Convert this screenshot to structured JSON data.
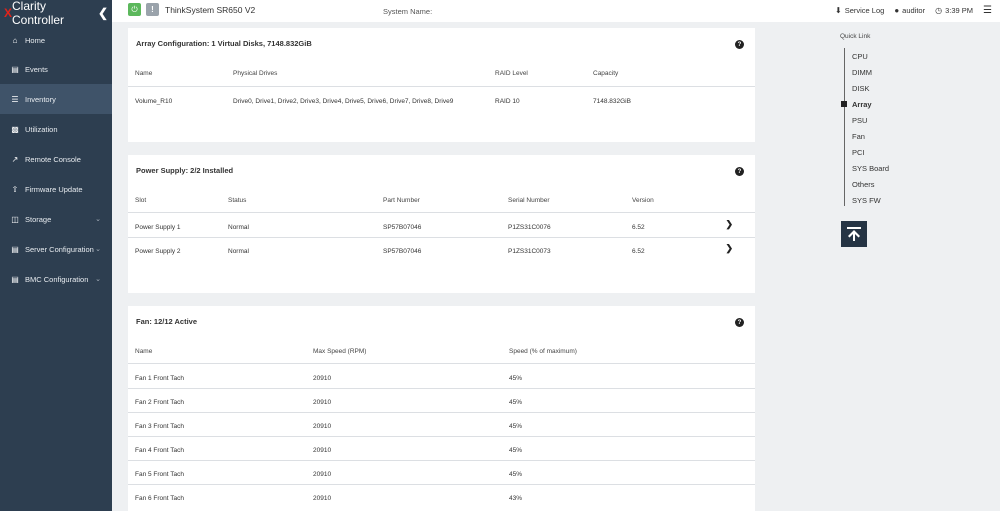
{
  "sidebar": {
    "brand_x": "X",
    "brand_rest": "Clarity Controller",
    "items": [
      {
        "label": "Home"
      },
      {
        "label": "Events"
      },
      {
        "label": "Inventory"
      },
      {
        "label": "Utilization"
      },
      {
        "label": "Remote Console"
      },
      {
        "label": "Firmware Update"
      },
      {
        "label": "Storage"
      },
      {
        "label": "Server Configuration"
      },
      {
        "label": "BMC Configuration"
      }
    ]
  },
  "topbar": {
    "model": "ThinkSystem SR650 V2",
    "system_name_label": "System Name:",
    "service_log": "Service Log",
    "user": "auditor",
    "time": "3:39 PM"
  },
  "array": {
    "title": "Array Configuration:  1 Virtual Disks, 7148.832GiB",
    "headers": [
      "Name",
      "Physical Drives",
      "RAID Level",
      "Capacity"
    ],
    "rows": [
      [
        "Volume_R10",
        "Drive0, Drive1, Drive2, Drive3, Drive4, Drive5, Drive6, Drive7, Drive8, Drive9",
        "RAID 10",
        "7148.832GiB"
      ]
    ]
  },
  "power": {
    "title": "Power Supply:  2/2 Installed",
    "headers": [
      "Slot",
      "Status",
      "Part Number",
      "Serial Number",
      "Version"
    ],
    "rows": [
      [
        "Power Supply 1",
        "Normal",
        "SP57B07046",
        "P1ZS31C0076",
        "6.52"
      ],
      [
        "Power Supply 2",
        "Normal",
        "SP57B07046",
        "P1ZS31C0073",
        "6.52"
      ]
    ]
  },
  "fan": {
    "title": "Fan:  12/12 Active",
    "headers": [
      "Name",
      "Max Speed (RPM)",
      "Speed (% of maximum)"
    ],
    "rows": [
      [
        "Fan 1 Front Tach",
        "20910",
        "45%"
      ],
      [
        "Fan 2 Front Tach",
        "20910",
        "45%"
      ],
      [
        "Fan 3 Front Tach",
        "20910",
        "45%"
      ],
      [
        "Fan 4 Front Tach",
        "20910",
        "45%"
      ],
      [
        "Fan 5 Front Tach",
        "20910",
        "45%"
      ],
      [
        "Fan 6 Front Tach",
        "20910",
        "43%"
      ]
    ]
  },
  "quick_link": {
    "title": "Quick Link",
    "items": [
      "CPU",
      "DIMM",
      "DISK",
      "Array",
      "PSU",
      "Fan",
      "PCI",
      "SYS Board",
      "Others",
      "SYS FW"
    ],
    "active": "Array"
  },
  "colors": {
    "sidebar_bg": "#2d3e50",
    "sidebar_active": "#3f5369",
    "brand_accent": "#e2231a",
    "power_on": "#5cb85c"
  }
}
